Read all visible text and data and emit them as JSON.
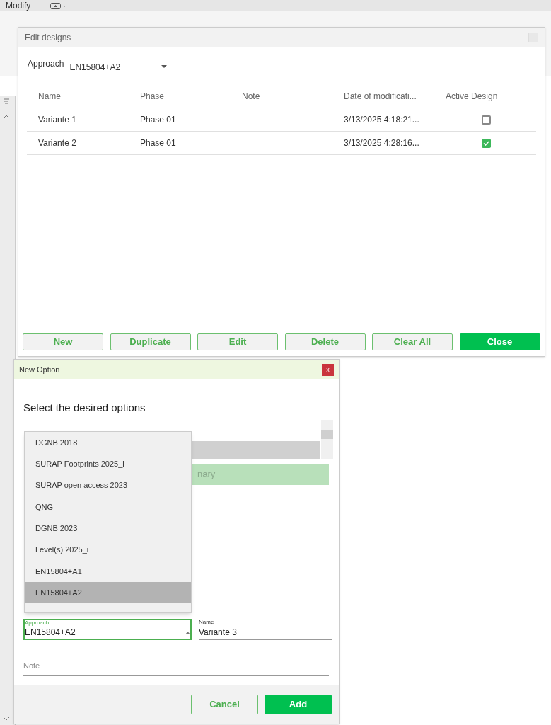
{
  "app": {
    "menu": "Modify"
  },
  "edit_designs": {
    "title": "Edit designs",
    "approach_label": "Approach",
    "approach_value": "EN15804+A2",
    "columns": [
      "Name",
      "Phase",
      "Note",
      "Date of modificati...",
      "Active Design"
    ],
    "rows": [
      {
        "name": "Variante 1",
        "phase": "Phase 01",
        "date": "3/13/2025 4:18:21...",
        "checked": false
      },
      {
        "name": "Variante 2",
        "phase": "Phase 01",
        "date": "3/13/2025 4:28:16...",
        "checked": true
      }
    ],
    "buttons": [
      {
        "label": "New",
        "kind": "outline"
      },
      {
        "label": "Duplicate",
        "kind": "outline"
      },
      {
        "label": "Edit",
        "kind": "outline"
      },
      {
        "label": "Delete",
        "kind": "outline"
      },
      {
        "label": "Clear All",
        "kind": "outline"
      },
      {
        "label": "Close",
        "kind": "primary"
      }
    ]
  },
  "new_option": {
    "title": "New Option",
    "close": "x",
    "heading": "Select the desired options",
    "green_row_text": "nary",
    "dropdown_items": [
      {
        "label": "DGNB 2018",
        "selected": false
      },
      {
        "label": "SURAP Footprints 2025_i",
        "selected": false
      },
      {
        "label": "SURAP open access 2023",
        "selected": false
      },
      {
        "label": "QNG",
        "selected": false
      },
      {
        "label": "DGNB 2023",
        "selected": false
      },
      {
        "label": "Level(s) 2025_i",
        "selected": false
      },
      {
        "label": "EN15804+A1",
        "selected": false
      },
      {
        "label": "EN15804+A2",
        "selected": true
      }
    ],
    "approach": {
      "label": "Approach",
      "value": "EN15804+A2"
    },
    "name": {
      "label": "Name",
      "value": "Variante 3"
    },
    "note": {
      "placeholder": "Note"
    },
    "buttons": [
      {
        "label": "Cancel",
        "kind": "outline"
      },
      {
        "label": "Add",
        "kind": "primary"
      }
    ]
  }
}
